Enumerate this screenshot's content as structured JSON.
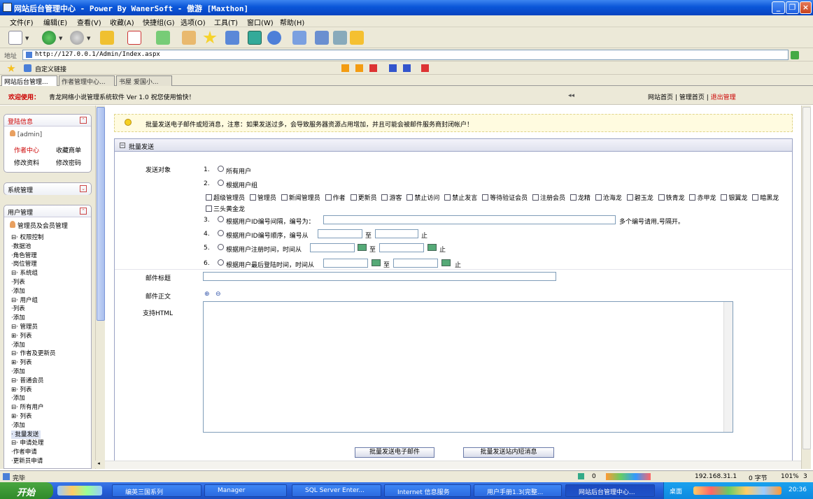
{
  "window": {
    "title": "网站后台管理中心 - Power By WanerSoft - 傲游 [Maxthon]",
    "buttons": [
      "_",
      "❐",
      "×"
    ]
  },
  "menu": [
    "文件(F)",
    "编辑(E)",
    "查看(V)",
    "收藏(A)",
    "快捷组(G)",
    "选项(O)",
    "工具(T)",
    "窗口(W)",
    "帮助(H)"
  ],
  "address": {
    "label": "地址",
    "url": "http://127.0.0.1/Admin/Index.aspx"
  },
  "links": {
    "label": "自定义链接"
  },
  "tabs": [
    "网站后台管理...",
    "作者管理中心...",
    "书屋 爱国小..."
  ],
  "topstrip": {
    "welcome": "欢迎使用：",
    "system": "青龙网络小说管理系统软件  Ver 1.0   祝您使用愉快！",
    "arrow": "◂◂",
    "link_home": "网站首页",
    "link_admin": "管理首页",
    "link_logout": "退出管理",
    "sep": "|"
  },
  "sidebar": {
    "login": {
      "title": "登陆信息",
      "user": "[admin]",
      "links": [
        "作者中心",
        "收藏商单",
        "修改资料",
        "修改密码"
      ]
    },
    "system": {
      "title": "系统管理"
    },
    "users": {
      "title": "用户管理",
      "subtitle": "管理员及会员管理",
      "tree": [
        "⊟· 权限控制",
        "    ·数据池",
        "    ·角色管理",
        "    ·岗位管理",
        "⊟· 系统组",
        "    ·列表",
        "    ·添加",
        "⊟· 用户组",
        "    ·列表",
        "    ·添加",
        "⊟· 管理员",
        "  ⊞· 列表",
        "    ·添加",
        "⊟· 作者及更新员",
        "  ⊞· 列表",
        "    ·添加",
        "⊟· 普通会员",
        "  ⊞· 列表",
        "    ·添加",
        "⊟· 所有用户",
        "  ⊞· 列表",
        "    ·添加",
        "· 批量发送",
        "⊟· 申请处理",
        "    ·作者申请",
        "    ·更新员申请"
      ]
    }
  },
  "notice": "批量发送电子邮件或短消息，注意：如果发送过多，会导致服务器资源占用增加，并且可能会被邮件服务商封闭帐户！",
  "form": {
    "section_title": "批量发送",
    "target_label": "发送对象",
    "options": [
      {
        "num": "1.",
        "text": "所有用户"
      },
      {
        "num": "2.",
        "text": "根据用户组"
      },
      {
        "num": "3.",
        "text": "根据用户ID编号间隔，编号为："
      },
      {
        "num": "4.",
        "text": "根据用户ID编号顺序，编号从"
      },
      {
        "num": "5.",
        "text": "根据用户注册时间，时间从"
      },
      {
        "num": "6.",
        "text": "根据用户最后登陆时间，时间从"
      }
    ],
    "groups_row1": [
      "超级管理员",
      "管理员",
      "新闻管理员",
      "作者",
      "更新员",
      "游客",
      "禁止访问",
      "禁止发言",
      "等待验证会员",
      "注册会员",
      "龙精",
      "沧海龙",
      "碧玉龙",
      "铁青龙",
      "赤甲龙"
    ],
    "groups_row2": [
      "银翼龙",
      "暗黑龙",
      "三头黄金龙"
    ],
    "multi_hint": "多个编号请用,号隔开。",
    "to": "至",
    "end": "止",
    "subject_label": "邮件标题",
    "body_label": "邮件正文",
    "html_label": "支持HTML",
    "zoom_icons": [
      "⊕",
      "⊖"
    ],
    "btn_email": "批量发送电子邮件",
    "btn_msg": "批量发送站内短消息"
  },
  "status": {
    "left": "完毕",
    "ip": "192.168.31.1",
    "bytes": "0 字节",
    "zoom": "101%",
    "count": "0",
    "num3": "3"
  },
  "taskbar": {
    "start": "开始",
    "tasks": [
      "编英三国系列",
      "Manager",
      "SQL Server Enter...",
      "Internet 信息服务",
      "用户手册1.3(完整...",
      "网站后台管理中心..."
    ],
    "desktop": "桌面",
    "time": "20:36"
  }
}
